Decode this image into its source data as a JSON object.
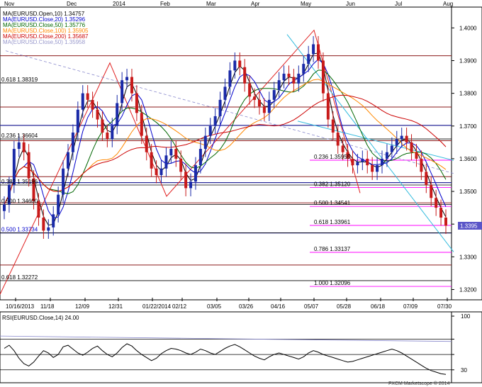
{
  "chart_data": {
    "type": "line",
    "legend": [
      {
        "text": "MA(EURUSD.Open,10) 1.34757",
        "color": "#000000"
      },
      {
        "text": "MA(EURUSD.Close,20) 1.35296",
        "color": "#0000cc"
      },
      {
        "text": "MA(EURUSD.Close,50) 1.35776",
        "color": "#006600"
      },
      {
        "text": "MA(EURUSD.Close,100) 1.35905",
        "color": "#ff8800"
      },
      {
        "text": "MA(EURUSD.Close,200) 1.35687",
        "color": "#cc0000"
      },
      {
        "text": "MA(EURUSD.Close,50) 1.35958",
        "color": "#9999cc"
      }
    ],
    "month_labels": [
      "Nov",
      "Dec",
      "2014",
      "Feb",
      "Mar",
      "Apr",
      "May",
      "Jun",
      "Jul",
      "Aug"
    ],
    "date_labels": [
      "10/16/2013",
      "11/18",
      "12/09",
      "12/31",
      "01/22/2014",
      "02/12",
      "03/05",
      "03/26",
      "04/16",
      "05/07",
      "05/28",
      "06/18",
      "07/09",
      "07/30"
    ],
    "ylim": [
      1.3175,
      1.4055
    ],
    "yticks": [
      1.32,
      1.33,
      1.34,
      1.35,
      1.36,
      1.37,
      1.38,
      1.39,
      1.4
    ],
    "ytick_labels": [
      "1.3200",
      "1.3300",
      "",
      "1.3500",
      "1.3600",
      "1.3700",
      "1.3800",
      "1.3900",
      "1.4000"
    ],
    "last_price": "1.3395",
    "left_fib": [
      {
        "label": "0.618 1.38319",
        "value": 1.38319,
        "color": "#000000"
      },
      {
        "label": "0.236 1.36604",
        "value": 1.36604,
        "color": "#000000"
      },
      {
        "label": "0.382 1.35196",
        "value": 1.35196,
        "color": "#000000"
      },
      {
        "label": "0.500 1.34600",
        "value": 1.346,
        "color": "#000000"
      },
      {
        "label": "0.500 1.33734",
        "value": 1.33734,
        "color": "#0000cc"
      },
      {
        "label": "0.618 1.32272",
        "value": 1.32272,
        "color": "#000000"
      }
    ],
    "right_fib": [
      {
        "label": "0.236 1.35955",
        "value": 1.35955
      },
      {
        "label": "0.382 1.35120",
        "value": 1.3512
      },
      {
        "label": "0.500 1.34541",
        "value": 1.34541
      },
      {
        "label": "0.618 1.33961",
        "value": 1.33961
      },
      {
        "label": "0.786 1.33137",
        "value": 1.33137
      },
      {
        "label": "1.000 1.32096",
        "value": 1.32096
      }
    ],
    "maroon_levels": [
      1.3915,
      1.3758,
      1.3655,
      1.3545,
      1.3465,
      1.3275
    ],
    "blue_levels": [
      1.3702,
      1.3527,
      1.3373
    ],
    "price_series": [
      1.346,
      1.352,
      1.363,
      1.365,
      1.362,
      1.354,
      1.347,
      1.342,
      1.338,
      1.339,
      1.343,
      1.349,
      1.357,
      1.362,
      1.368,
      1.375,
      1.38,
      1.378,
      1.375,
      1.372,
      1.368,
      1.366,
      1.37,
      1.377,
      1.384,
      1.385,
      1.38,
      1.374,
      1.367,
      1.362,
      1.357,
      1.355,
      1.357,
      1.361,
      1.363,
      1.36,
      1.356,
      1.351,
      1.353,
      1.358,
      1.363,
      1.367,
      1.37,
      1.373,
      1.378,
      1.382,
      1.387,
      1.39,
      1.388,
      1.383,
      1.379,
      1.378,
      1.376,
      1.374,
      1.378,
      1.381,
      1.384,
      1.386,
      1.385,
      1.383,
      1.386,
      1.389,
      1.392,
      1.395,
      1.39,
      1.38,
      1.372,
      1.368,
      1.364,
      1.362,
      1.36,
      1.358,
      1.359,
      1.36,
      1.358,
      1.356,
      1.358,
      1.36,
      1.362,
      1.364,
      1.366,
      1.367,
      1.365,
      1.362,
      1.36,
      1.356,
      1.352,
      1.348,
      1.345,
      1.342,
      1.3395
    ],
    "price_low": 1.3295,
    "price_high": 1.3993,
    "rsi": {
      "label": "RSI(EURUSD.Close,14) 24.00",
      "ylim": [
        15,
        100
      ],
      "yticks": [
        100,
        70,
        50,
        30
      ],
      "ytick_labels": [
        "100",
        "",
        "",
        "30"
      ],
      "levels": [
        70,
        50,
        30
      ],
      "values": [
        58,
        62,
        55,
        45,
        38,
        35,
        40,
        48,
        55,
        52,
        46,
        50,
        60,
        62,
        57,
        52,
        49,
        53,
        58,
        61,
        55,
        50,
        47,
        52,
        59,
        64,
        61,
        55,
        50,
        46,
        42,
        45,
        51,
        55,
        58,
        57,
        55,
        52,
        50,
        53,
        57,
        55,
        52,
        50,
        54,
        58,
        61,
        63,
        60,
        56,
        52,
        48,
        45,
        43,
        47,
        50,
        52,
        50,
        48,
        46,
        44,
        47,
        52,
        55,
        53,
        50,
        48,
        46,
        44,
        42,
        40,
        41,
        43,
        45,
        47,
        49,
        51,
        53,
        55,
        57,
        55,
        52,
        48,
        44,
        40,
        36,
        32,
        29,
        27,
        25,
        24
      ]
    },
    "watermark": "FXCM Marketscope © 2014"
  }
}
